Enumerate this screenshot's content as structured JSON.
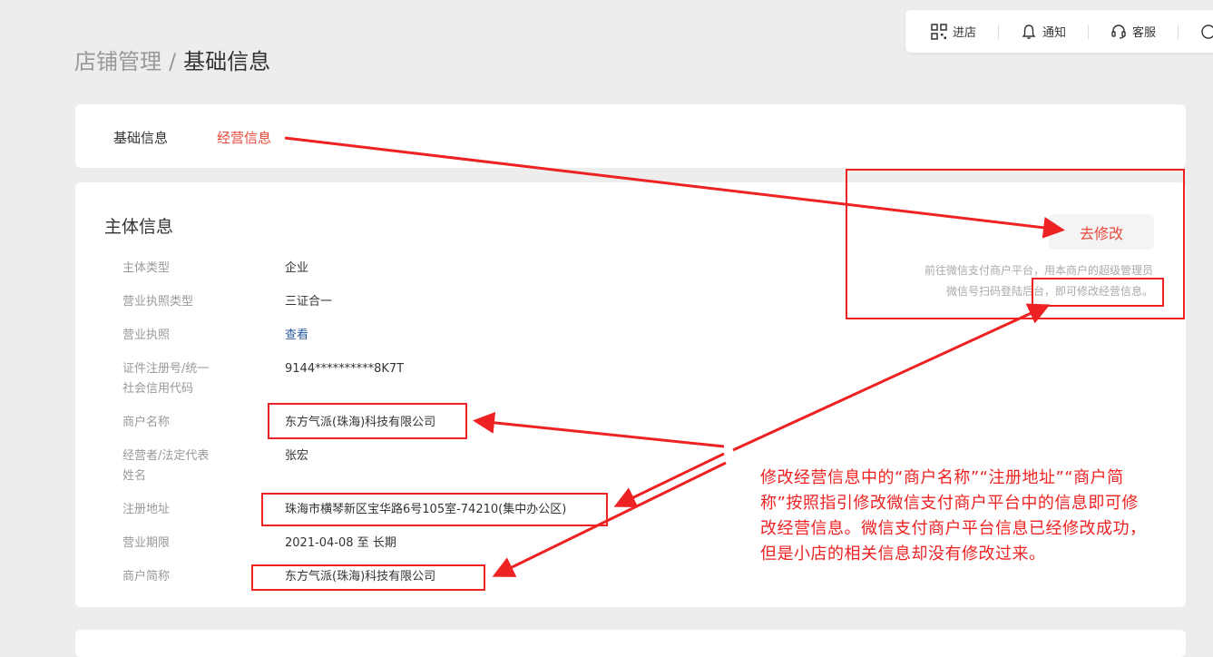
{
  "topbar": {
    "items": [
      {
        "label": "进店",
        "icon": "qrcode-icon"
      },
      {
        "label": "通知",
        "icon": "bell-icon"
      },
      {
        "label": "客服",
        "icon": "headset-icon"
      }
    ]
  },
  "breadcrumb": {
    "parent": "店铺管理",
    "separator": "/",
    "current": "基础信息"
  },
  "tabs": [
    {
      "label": "基础信息",
      "active": false
    },
    {
      "label": "经营信息",
      "active": true
    }
  ],
  "main": {
    "section_title": "主体信息",
    "edit_button": "去修改",
    "hint_line1": "前往微信支付商户平台，用本商户的超级管理员",
    "hint_line2": "微信号扫码登陆后台，即可修改经营信息。",
    "fields": [
      {
        "label": "主体类型",
        "value": "企业"
      },
      {
        "label": "营业执照类型",
        "value": "三证合一"
      },
      {
        "label": "营业执照",
        "value": "查看"
      },
      {
        "label": "证件注册号/统一",
        "label2": "社会信用代码",
        "value": "9144**********8K7T"
      },
      {
        "label": "商户名称",
        "value": "东方气派(珠海)科技有限公司"
      },
      {
        "label": "经营者/法定代表",
        "label2": "姓名",
        "value": "张宏"
      },
      {
        "label": "注册地址",
        "value": "珠海市横琴新区宝华路6号105室-74210(集中办公区)"
      },
      {
        "label": "营业期限",
        "value": "2021-04-08 至 长期"
      },
      {
        "label": "商户简称",
        "value": "东方气派(珠海)科技有限公司"
      }
    ]
  },
  "annotation": {
    "text": "修改经营信息中的“商户名称”“注册地址”“商户简称”按照指引修改微信支付商户平台中的信息即可修改经营信息。微信支付商户平台信息已经修改成功，但是小店的相关信息却没有修改过来。",
    "color": "#e22222"
  },
  "colors": {
    "accent": "#e8493a",
    "link": "#2c5aa0",
    "background": "#ededed"
  }
}
